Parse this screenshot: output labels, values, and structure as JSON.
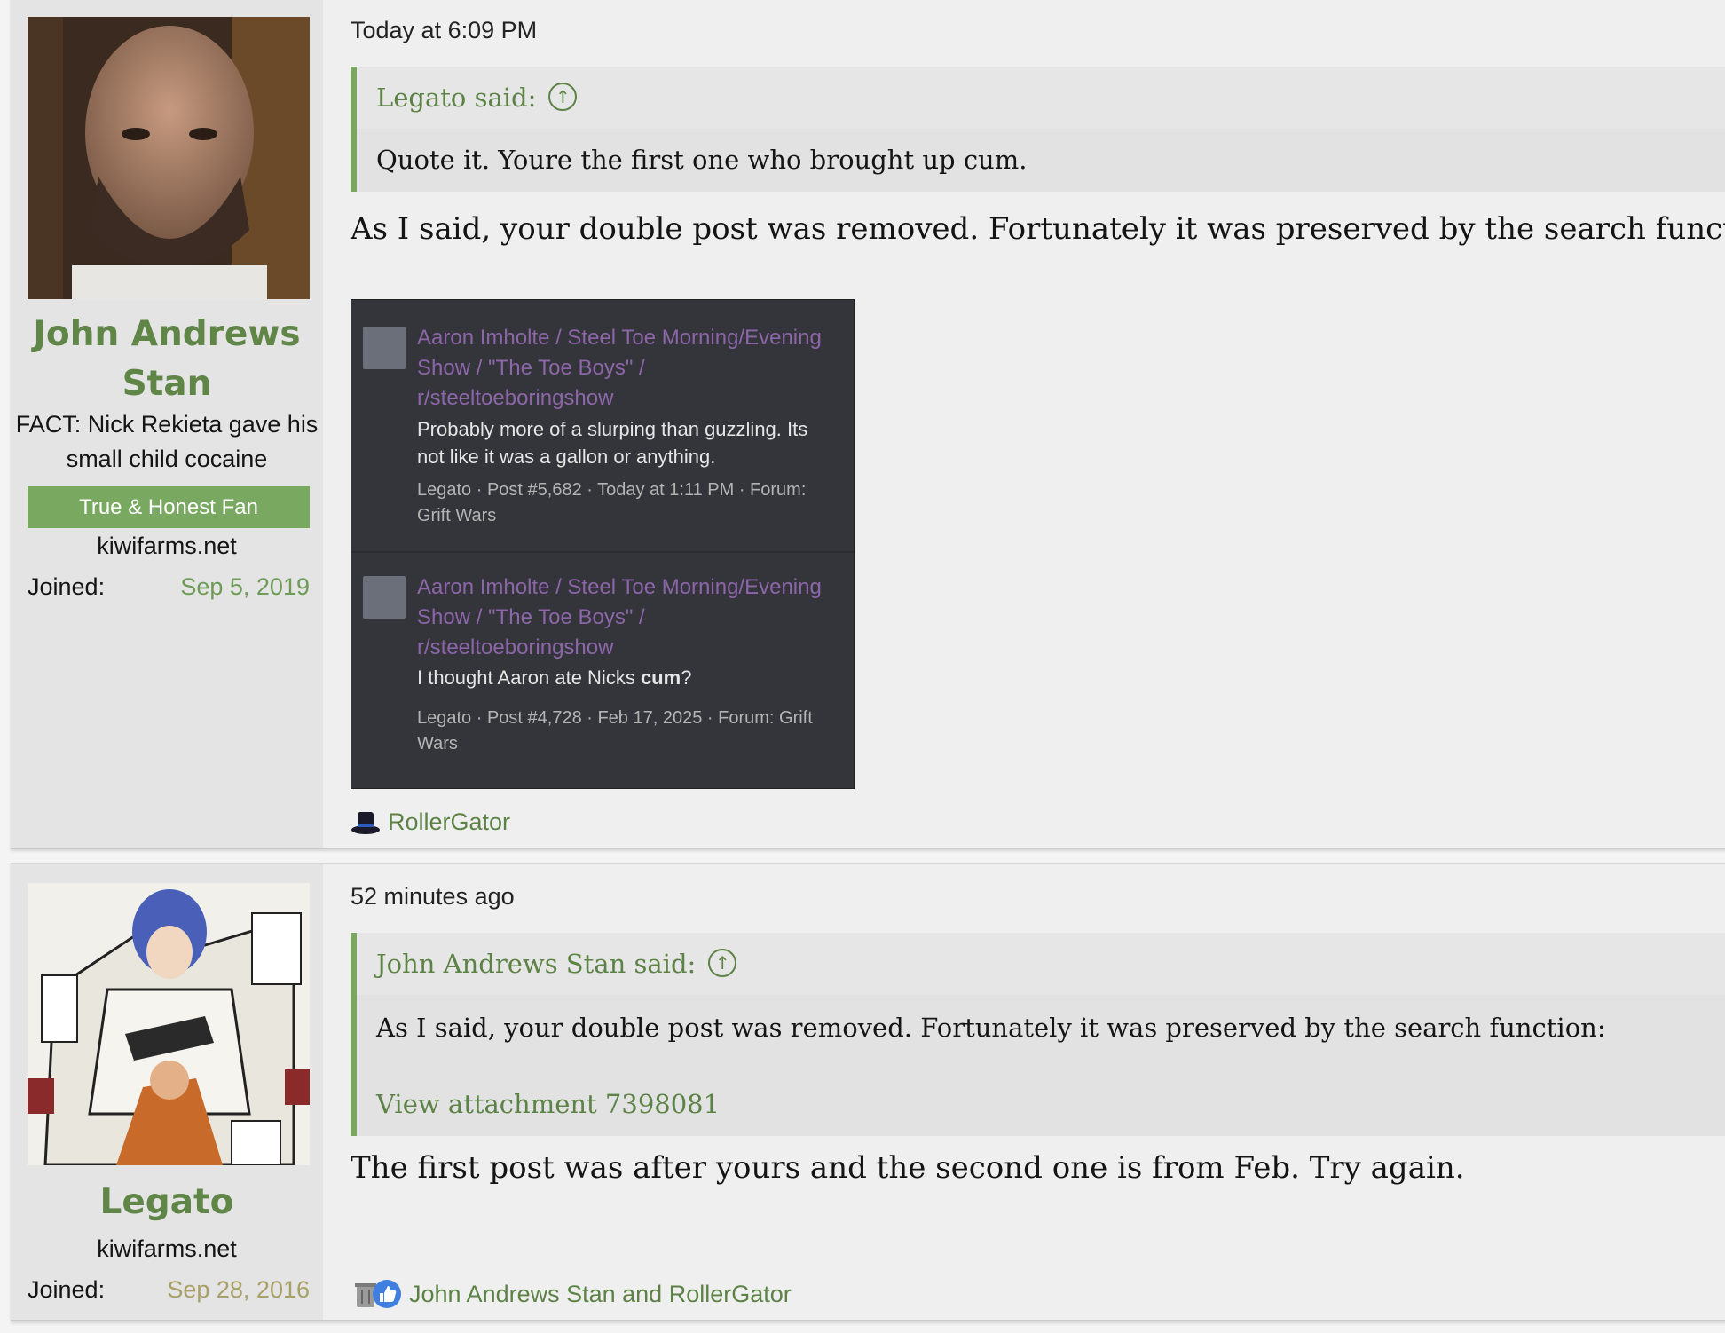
{
  "posts": [
    {
      "user": {
        "name": "John Andrews Stan",
        "title": "FACT: Nick Rekieta gave his small child cocaine",
        "banner": "True & Honest Fan",
        "site": "kiwifarms.net",
        "joined_label": "Joined:",
        "joined_date": "Sep 5, 2019"
      },
      "time": "Today at 6:09 PM",
      "quote": {
        "author_said": "Legato said:",
        "text": "Quote it. Youre the first one who brought up cum."
      },
      "text": "As I said, your double post was removed. Fortunately it was preserved by the search function:",
      "attachment": {
        "results": [
          {
            "title": "Aaron Imholte / Steel Toe Morning/Evening Show / \"The Toe Boys\" / r/steeltoeboringshow",
            "snippet": "Probably more of a slurping than guzzling. Its not like it was a gallon or anything.",
            "meta": "Legato · Post #5,682 · Today at 1:11 PM · Forum: Grift Wars"
          },
          {
            "title": "Aaron Imholte / Steel Toe Morning/Evening Show / \"The Toe Boys\" / r/steeltoeboringshow",
            "snippet_pre": "I thought Aaron ate Nicks ",
            "snippet_bold": "cum",
            "snippet_post": "?",
            "meta": "Legato · Post #4,728 · Feb 17, 2025 · Forum: Grift Wars"
          }
        ]
      },
      "reactions": "RollerGator"
    },
    {
      "user": {
        "name": "Legato",
        "site": "kiwifarms.net",
        "joined_label": "Joined:",
        "joined_date": "Sep 28, 2016"
      },
      "time": "52 minutes ago",
      "quote": {
        "author_said": "John Andrews Stan said:",
        "text": "As I said, your double post was removed. Fortunately it was preserved by the search function:",
        "link": "View attachment 7398081"
      },
      "text": "The first post was after yours and the second one is from Feb. Try again.",
      "reactions": "John Andrews Stan and RollerGator"
    }
  ],
  "colors": {
    "accent_green": "#5f8547",
    "banner_green": "#79a961",
    "quote_bar": "#7aa662",
    "search_title_purple": "#8c66a8",
    "joined_gold": "#a8a066"
  },
  "icons": {
    "quote_jump": "arrow-up-circle-icon",
    "reaction_1": "top-hat-icon",
    "reaction_2a": "trash-can-icon",
    "reaction_2b": "thumbs-up-icon"
  }
}
